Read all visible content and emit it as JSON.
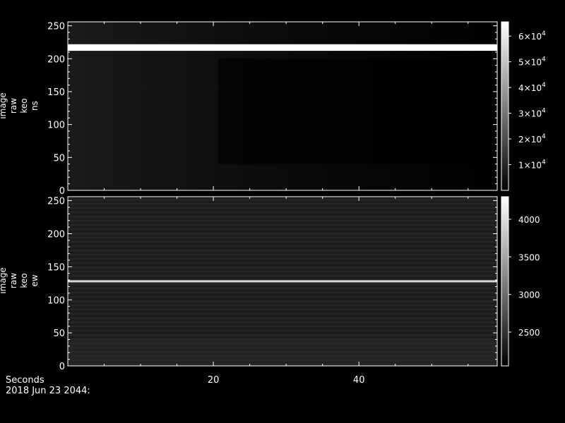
{
  "footer": {
    "xaxis_label": "Seconds",
    "date_label": "2018 Jun 23 2044:"
  },
  "chart_data": [
    {
      "type": "heatmap",
      "ylabel": [
        "image",
        "raw",
        "keo",
        "ns"
      ],
      "xlim": [
        0,
        59
      ],
      "ylim": [
        0,
        256
      ],
      "yticks": [
        0,
        50,
        100,
        150,
        200,
        250
      ],
      "xticks": [
        20,
        40
      ],
      "xtick_labels": [],
      "colorbar": {
        "range": [
          0,
          65536
        ],
        "tick_values": [
          10000,
          20000,
          30000,
          40000,
          50000,
          60000
        ],
        "tick_labels": [
          {
            "base": "1×10",
            "exp": "4"
          },
          {
            "base": "2×10",
            "exp": "4"
          },
          {
            "base": "3×10",
            "exp": "4"
          },
          {
            "base": "4×10",
            "exp": "4"
          },
          {
            "base": "5×10",
            "exp": "4"
          },
          {
            "base": "6×10",
            "exp": "4"
          }
        ]
      },
      "features": [
        {
          "kind": "bright_band",
          "y_from": 212,
          "y_to": 222
        }
      ],
      "background": "#0a0a0a",
      "grid": false
    },
    {
      "type": "heatmap",
      "ylabel": [
        "image",
        "raw",
        "keo",
        "ew"
      ],
      "xlim": [
        0,
        59
      ],
      "ylim": [
        0,
        256
      ],
      "yticks": [
        0,
        50,
        100,
        150,
        200,
        250
      ],
      "xticks": [
        20,
        40
      ],
      "xtick_labels": [
        "20",
        "40"
      ],
      "colorbar": {
        "range": [
          2050,
          4300
        ],
        "tick_values": [
          2500,
          3000,
          3500,
          4000
        ],
        "tick_labels": [
          {
            "base": "2500",
            "exp": ""
          },
          {
            "base": "3000",
            "exp": ""
          },
          {
            "base": "3500",
            "exp": ""
          },
          {
            "base": "4000",
            "exp": ""
          }
        ]
      },
      "features": [
        {
          "kind": "bright_line",
          "y": 128
        }
      ],
      "background": "#1e1e1e",
      "grid": false
    }
  ]
}
